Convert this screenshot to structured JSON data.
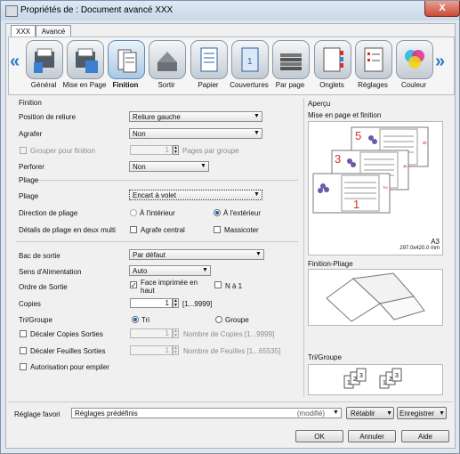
{
  "window": {
    "title": "Propriétés de : Document avancé XXX",
    "close_label": "X"
  },
  "tabs": [
    {
      "label": "XXX"
    },
    {
      "label": "Avancé"
    }
  ],
  "categories": [
    {
      "label": "Général",
      "icon": "general-icon"
    },
    {
      "label": "Mise en Page",
      "icon": "layout-icon"
    },
    {
      "label": "Finition",
      "icon": "finishing-icon",
      "selected": true
    },
    {
      "label": "Sortir",
      "icon": "output-icon"
    },
    {
      "label": "Papier",
      "icon": "paper-icon"
    },
    {
      "label": "Couvertures",
      "icon": "covers-icon"
    },
    {
      "label": "Par page",
      "icon": "per-page-icon"
    },
    {
      "label": "Onglets",
      "icon": "tabs-icon"
    },
    {
      "label": "Réglages",
      "icon": "settings-icon"
    },
    {
      "label": "Couleur",
      "icon": "color-icon"
    }
  ],
  "finition": {
    "section_title": "Finition",
    "binding_label": "Position de reliure",
    "binding_value": "Reliure gauche",
    "staple_label": "Agrafer",
    "staple_value": "Non",
    "group_label": "Grouper pour finition",
    "group_value": "1",
    "group_suffix": "Pages par groupe",
    "punch_label": "Perforer",
    "punch_value": "Non"
  },
  "pliage": {
    "section_title": "Pliage",
    "fold_label": "Pliage",
    "fold_value": "Encart à volet",
    "direction_label": "Direction de pliage",
    "direction_in": "À l'intérieur",
    "direction_out": "À l'extérieur",
    "details_label": "Détails de pliage en deux multi",
    "center_staple": "Agrafe central",
    "trimmer": "Massicoter"
  },
  "sortie": {
    "tray_label": "Bac de sortie",
    "tray_value": "Par défaut",
    "feed_label": "Sens d'Alimentation",
    "feed_value": "Auto",
    "order_label": "Ordre de Sortie",
    "facedown_label": "Face imprimée en haut",
    "n1_label": "N à 1",
    "copies_label": "Copies",
    "copies_value": "1",
    "copies_range": "[1...9999]",
    "sortgroup_label": "Tri/Groupe",
    "sort_label": "Tri",
    "group_label": "Groupe",
    "offset_copies_label": "Décaler Copies Sorties",
    "offset_copies_value": "1",
    "offset_copies_suffix": "Nombre de Copies [1...9999]",
    "offset_sheets_label": "Décaler Feuilles Sorties",
    "offset_sheets_value": "1",
    "offset_sheets_suffix": "Nombre de Feuilles [1...65535]",
    "stack_label": "Autorisation pour empiler"
  },
  "apercu": {
    "title": "Aperçu",
    "layout_label": "Mise en page et finition",
    "paper_size": "A3",
    "paper_dims": "297.0x420.0 mm",
    "page_numbers": [
      "5",
      "6",
      "3",
      "4",
      "1",
      "2"
    ],
    "fold_label": "Finition-Pliage",
    "sortgroup_label": "Tri/Groupe",
    "stack_numbers": [
      "1",
      "2",
      "3"
    ]
  },
  "favorites": {
    "label": "Réglage favori",
    "value": "Réglages prédéfinis",
    "modified": "(modifié)",
    "restore_button": "Rétablir",
    "save_button": "Enregistrer"
  },
  "buttons": {
    "ok": "OK",
    "cancel": "Annuler",
    "help": "Aide"
  },
  "colors": {
    "accent": "#2b78c6",
    "page_number_red": "#d0302a"
  }
}
